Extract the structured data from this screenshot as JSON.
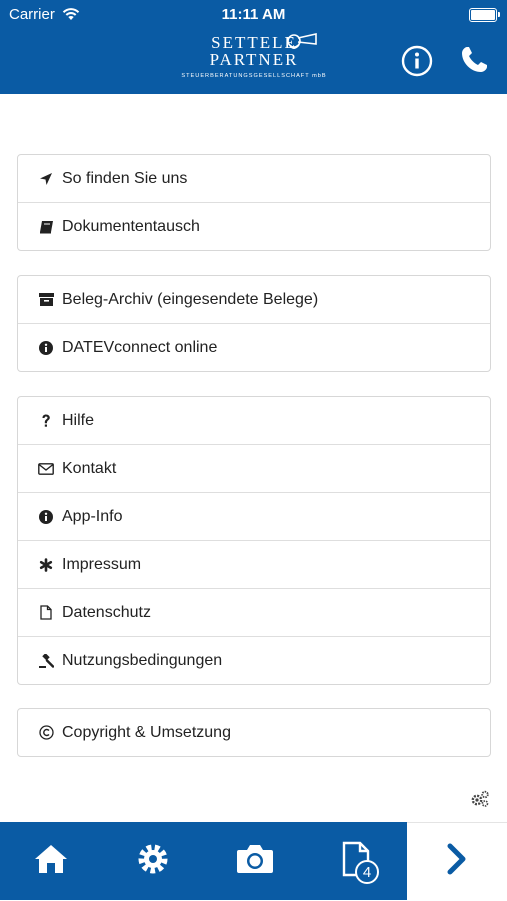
{
  "status_bar": {
    "carrier": "Carrier",
    "time": "11:11 AM"
  },
  "header": {
    "logo_line1": "SETTELE",
    "logo_line2": "PARTNER",
    "logo_tagline": "STEUERBERATUNGSGESELLSCHAFT mbB",
    "info_icon": "info-icon",
    "phone_icon": "phone-icon",
    "color": "#0a5ba4"
  },
  "menu": {
    "group1": [
      {
        "label": "So finden Sie uns",
        "icon": "location-arrow-icon"
      },
      {
        "label": "Dokumententausch",
        "icon": "book-icon"
      }
    ],
    "group2": [
      {
        "label": "Beleg-Archiv (eingesendete Belege)",
        "icon": "archive-icon"
      },
      {
        "label": "DATEVconnect online",
        "icon": "info-circle-icon"
      }
    ],
    "group3": [
      {
        "label": "Hilfe",
        "icon": "question-icon"
      },
      {
        "label": "Kontakt",
        "icon": "envelope-icon"
      },
      {
        "label": "App-Info",
        "icon": "info-circle-icon"
      },
      {
        "label": "Impressum",
        "icon": "asterisk-icon"
      },
      {
        "label": "Datenschutz",
        "icon": "file-icon"
      },
      {
        "label": "Nutzungsbedingungen",
        "icon": "gavel-icon"
      }
    ],
    "group4": [
      {
        "label": "Copyright & Umsetzung",
        "icon": "copyright-icon"
      }
    ]
  },
  "tabbar": {
    "items": [
      "home-icon",
      "settings-icon",
      "camera-icon",
      "documents-icon",
      "chevron-right-icon"
    ],
    "documents_badge": "4"
  }
}
